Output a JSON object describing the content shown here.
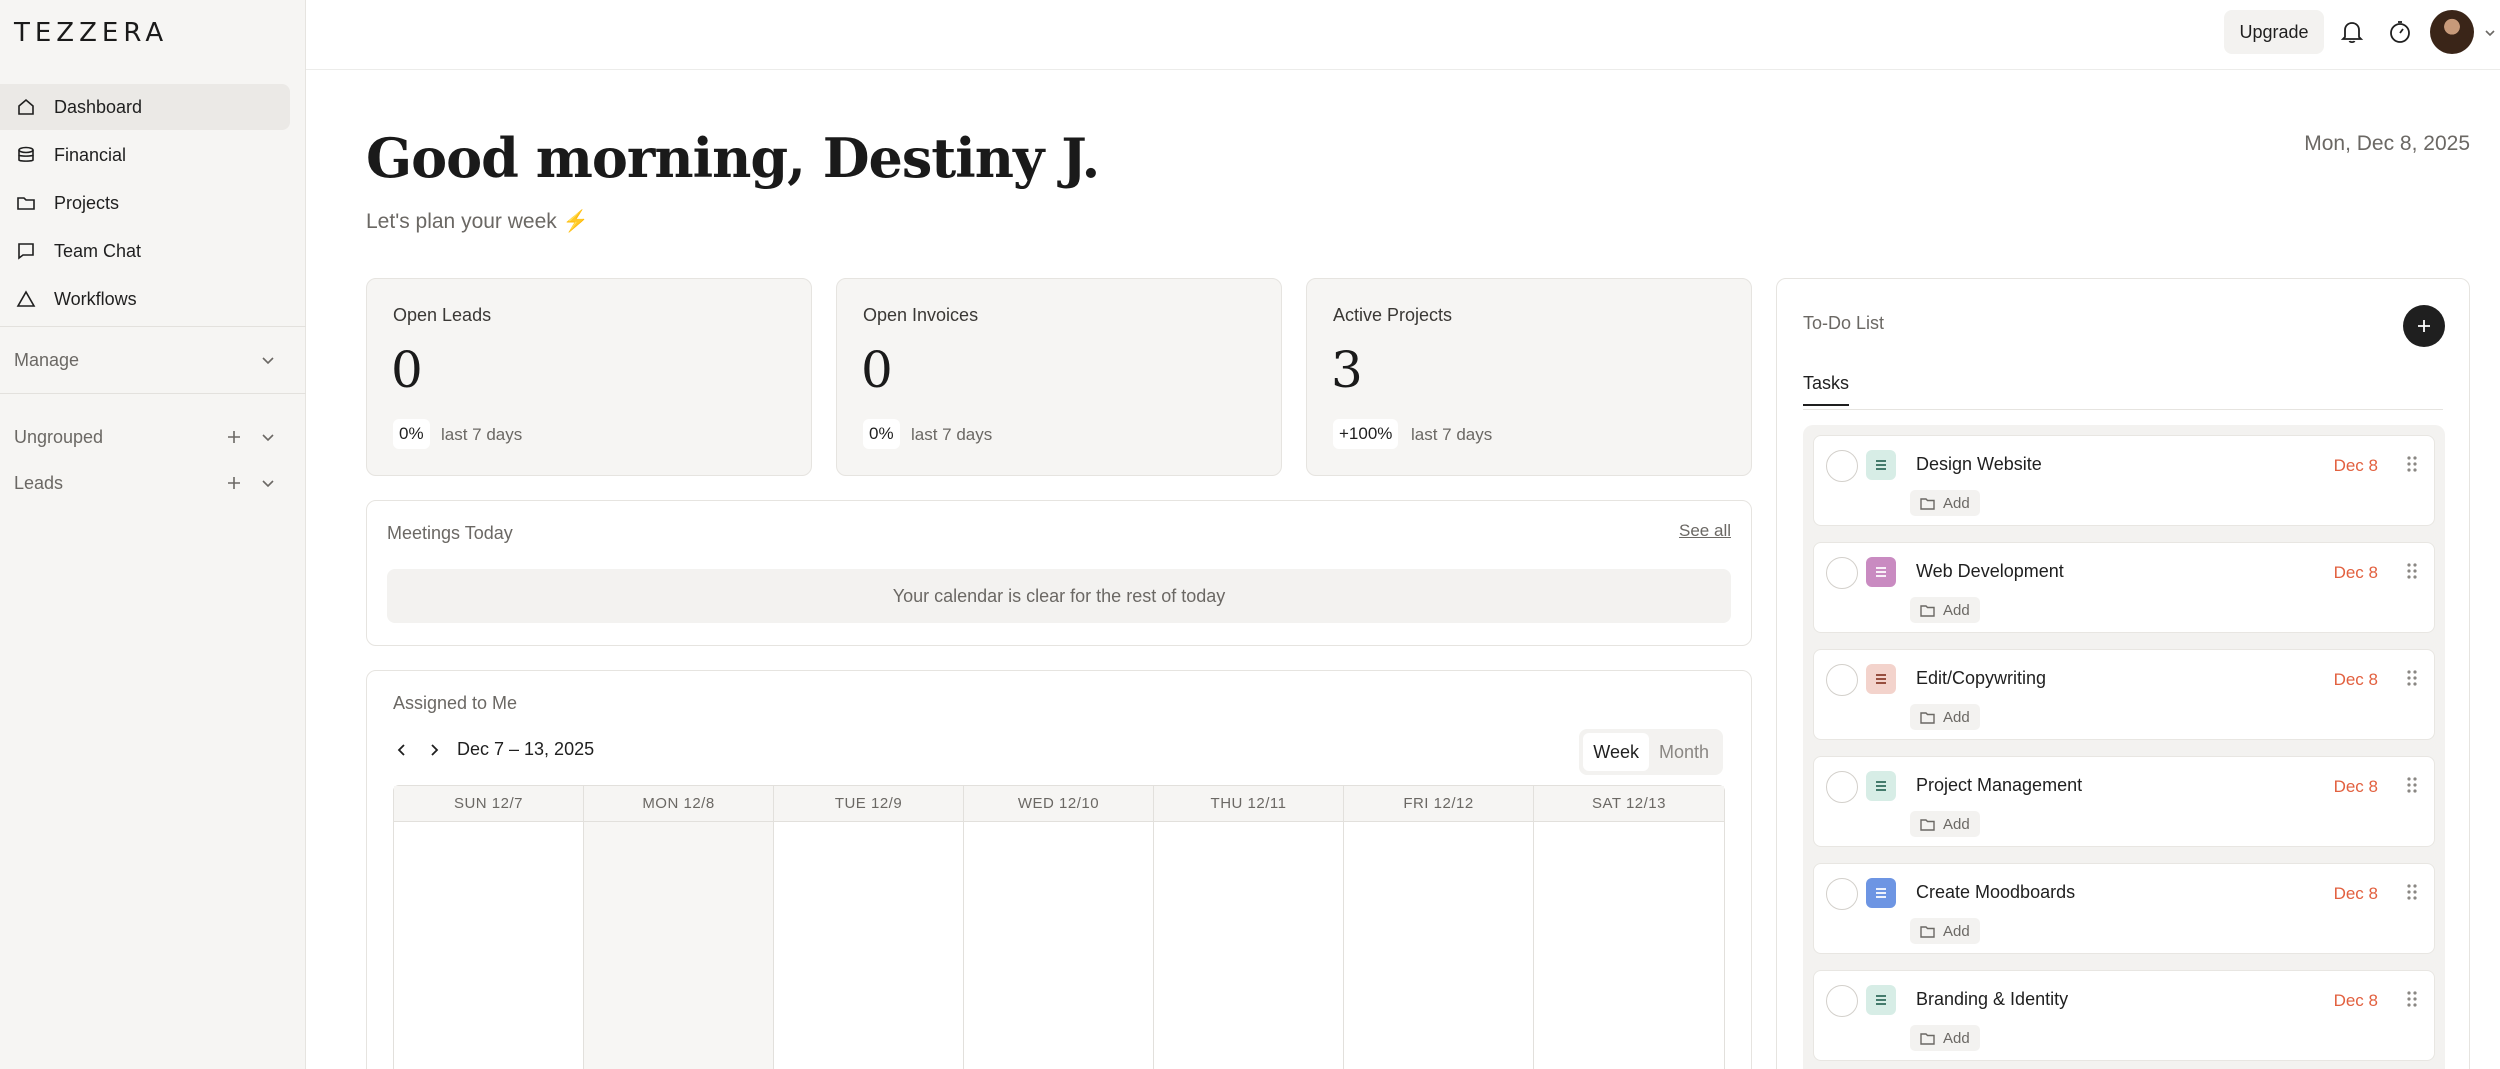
{
  "app": {
    "logo": "TEZZERA"
  },
  "sidebar": {
    "items": [
      {
        "label": "Dashboard",
        "icon": "home-icon",
        "active": true
      },
      {
        "label": "Financial",
        "icon": "database-icon"
      },
      {
        "label": "Projects",
        "icon": "folder-icon"
      },
      {
        "label": "Team Chat",
        "icon": "chat-icon"
      },
      {
        "label": "Workflows",
        "icon": "triangle-icon"
      }
    ],
    "manage": "Manage",
    "groups": [
      {
        "label": "Ungrouped"
      },
      {
        "label": "Leads"
      }
    ]
  },
  "topbar": {
    "upgrade_label": "Upgrade"
  },
  "header": {
    "greeting": "Good morning, Destiny J.",
    "subtitle": "Let's plan your week ⚡",
    "date": "Mon, Dec 8, 2025"
  },
  "stats": [
    {
      "title": "Open Leads",
      "value": "0",
      "change": "0%",
      "note": "last 7 days"
    },
    {
      "title": "Open Invoices",
      "value": "0",
      "change": "0%",
      "note": "last 7 days"
    },
    {
      "title": "Active Projects",
      "value": "3",
      "change": "+100%",
      "note": "last 7 days"
    }
  ],
  "meetings": {
    "title": "Meetings Today",
    "see_all": "See all",
    "empty": "Your calendar is clear for the rest of today"
  },
  "assigned": {
    "title": "Assigned to Me",
    "range": "Dec 7 – 13, 2025",
    "views": [
      "Week",
      "Month"
    ],
    "days": [
      "SUN 12/7",
      "MON 12/8",
      "TUE 12/9",
      "WED 12/10",
      "THU 12/11",
      "FRI 12/12",
      "SAT 12/13"
    ]
  },
  "todo": {
    "title": "To-Do List",
    "tab": "Tasks",
    "folder_label": "Add",
    "tasks": [
      {
        "name": "Design Website",
        "date": "Dec 8",
        "color": "#d7ede6",
        "ink": "#2f6b5b"
      },
      {
        "name": "Web Development",
        "date": "Dec 8",
        "color": "#c98bc1",
        "ink": "#ffffff"
      },
      {
        "name": "Edit/Copywriting",
        "date": "Dec 8",
        "color": "#f3d3cc",
        "ink": "#8a3b2b"
      },
      {
        "name": "Project Management",
        "date": "Dec 8",
        "color": "#d7ede6",
        "ink": "#2f6b5b"
      },
      {
        "name": "Create Moodboards",
        "date": "Dec 8",
        "color": "#6d95e3",
        "ink": "#ffffff"
      },
      {
        "name": "Branding & Identity",
        "date": "Dec 8",
        "color": "#d7ede6",
        "ink": "#2f6b5b"
      }
    ]
  }
}
